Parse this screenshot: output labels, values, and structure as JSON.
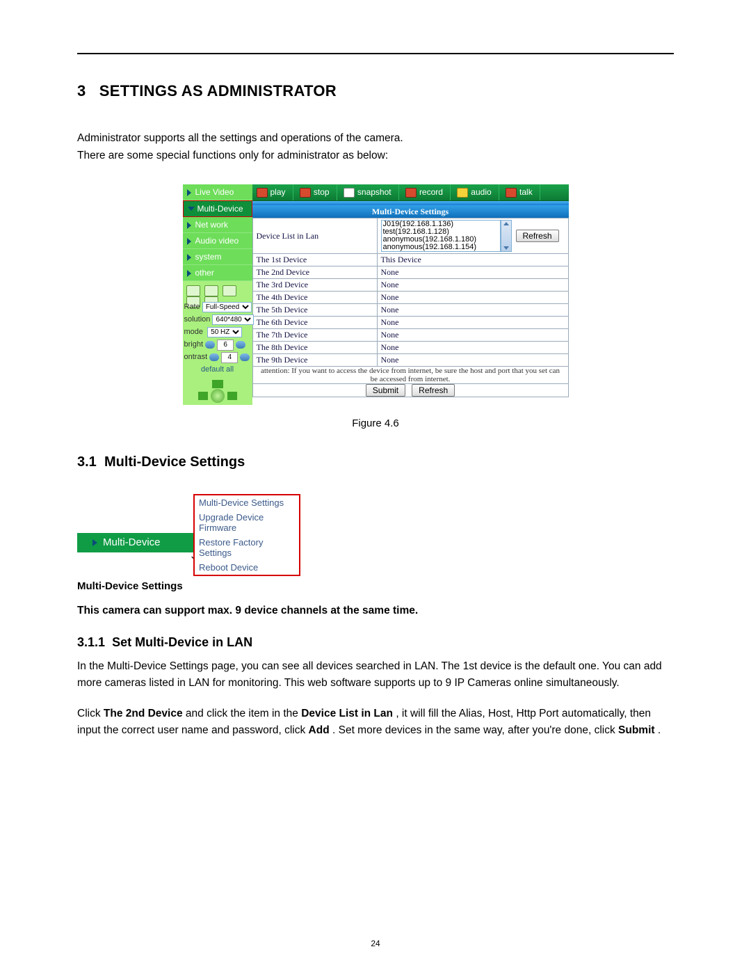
{
  "section": {
    "number": "3",
    "title": "SETTINGS AS ADMINISTRATOR"
  },
  "intro": {
    "line1": "Administrator supports all the settings and operations of the camera.",
    "line2": "There are some special functions only for administrator as below:"
  },
  "shot": {
    "sidebar": [
      "Live Video",
      "Multi-Device",
      "Net work",
      "Audio video",
      "system",
      "other"
    ],
    "toolbar": [
      "play",
      "stop",
      "snapshot",
      "record",
      "audio",
      "talk"
    ],
    "settings_title": "Multi-Device Settings",
    "list_label": "Device List in Lan",
    "lan": [
      "J019(192.168.1.136)",
      "test(192.168.1.128)",
      "anonymous(192.168.1.180)",
      "anonymous(192.168.1.154)"
    ],
    "refresh": "Refresh",
    "submit": "Submit",
    "rows": [
      {
        "label": "The 1st Device",
        "value": "This Device"
      },
      {
        "label": "The 2nd Device",
        "value": "None"
      },
      {
        "label": "The 3rd Device",
        "value": "None"
      },
      {
        "label": "The 4th Device",
        "value": "None"
      },
      {
        "label": "The 5th Device",
        "value": "None"
      },
      {
        "label": "The 6th Device",
        "value": "None"
      },
      {
        "label": "The 7th Device",
        "value": "None"
      },
      {
        "label": "The 8th Device",
        "value": "None"
      },
      {
        "label": "The 9th Device",
        "value": "None"
      }
    ],
    "attention": "attention: If you want to access the device from internet, be sure the host and port that you set can be accessed from internet.",
    "ctrl": {
      "rate_lbl": "Rate",
      "rate_val": "Full-Speed",
      "res_lbl": "solution",
      "res_val": "640*480",
      "mode_lbl": "mode",
      "mode_val": "50 HZ",
      "bright_lbl": "bright",
      "bright_val": "6",
      "contrast_lbl": "ontrast",
      "contrast_val": "4",
      "default": "default all"
    }
  },
  "figcap": "Figure 4.6",
  "sub31": {
    "number": "3.1",
    "title": "Multi-Device Settings"
  },
  "fig2": {
    "bar": "Multi-Device",
    "menu": [
      "Multi-Device Settings",
      "Upgrade Device Firmware",
      "Restore Factory Settings",
      "Reboot Device"
    ]
  },
  "text": {
    "mds_label": "Multi-Device Settings",
    "support": "This camera can support max. 9 device channels at the same time.",
    "lan_p1": "In the Multi-Device Settings page, you can see all devices searched in LAN. The 1st device is the default one. You can add more cameras listed in LAN for monitoring. This web software supports up to 9 IP Cameras online simultaneously.",
    "lan_p2": {
      "a": "Click ",
      "b": "The 2nd Device",
      "c": " and click the item in the ",
      "d": "Device List in Lan",
      "e": ", it will fill the Alias, Host, Http Port automatically, then input the correct user name and password, click ",
      "f": "Add",
      "g": ". Set more devices in the same way, after you're done, click ",
      "h": "Submit",
      "i": "."
    }
  },
  "sub311": {
    "number": "3.1.1",
    "title": "Set Multi-Device in LAN"
  },
  "page_number": "24"
}
